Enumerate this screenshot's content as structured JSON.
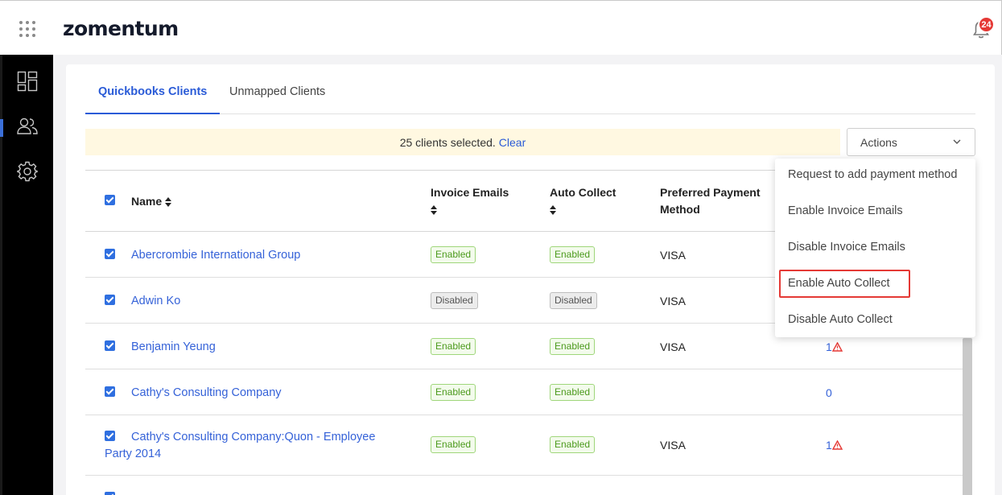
{
  "header": {
    "logo": "zomentum",
    "notification_count": "24"
  },
  "sidebar": {
    "items": [
      {
        "icon": "dashboard-icon"
      },
      {
        "icon": "users-icon"
      },
      {
        "icon": "gear-icon"
      }
    ]
  },
  "tabs": [
    {
      "label": "Quickbooks Clients",
      "active": true
    },
    {
      "label": "Unmapped Clients",
      "active": false
    }
  ],
  "selection": {
    "text": "25 clients selected.",
    "clear_label": "Clear"
  },
  "actions": {
    "label": "Actions",
    "menu": [
      "Request to add payment method",
      "Enable Invoice Emails",
      "Disable Invoice Emails",
      "Enable Auto Collect",
      "Disable Auto Collect"
    ],
    "highlighted": "Enable Auto Collect"
  },
  "table": {
    "headers": {
      "name": "Name",
      "invoice_emails": "Invoice Emails",
      "auto_collect": "Auto Collect",
      "preferred_payment_line1": "Preferred Payment",
      "preferred_payment_line2": "Method"
    },
    "rows": [
      {
        "name": "Abercrombie International Group",
        "invoice_emails": "Enabled",
        "auto_collect": "Enabled",
        "payment": "VISA",
        "count": ""
      },
      {
        "name": "Adwin Ko",
        "invoice_emails": "Disabled",
        "auto_collect": "Disabled",
        "payment": "VISA",
        "count": ""
      },
      {
        "name": "Benjamin Yeung",
        "invoice_emails": "Enabled",
        "auto_collect": "Enabled",
        "payment": "VISA",
        "count": "1"
      },
      {
        "name": "Cathy's Consulting Company",
        "invoice_emails": "Enabled",
        "auto_collect": "Enabled",
        "payment": "",
        "count": "0"
      },
      {
        "name_line1": "Cathy's Consulting Company:Quon - Employee",
        "name_line2": "Party 2014",
        "invoice_emails": "Enabled",
        "auto_collect": "Enabled",
        "payment": "VISA",
        "count": "1"
      }
    ]
  },
  "colors": {
    "accent": "#2a5bd7",
    "enabled": "#4c9a1d",
    "badge": "#e53935",
    "selection_bg": "#fff8e1"
  }
}
